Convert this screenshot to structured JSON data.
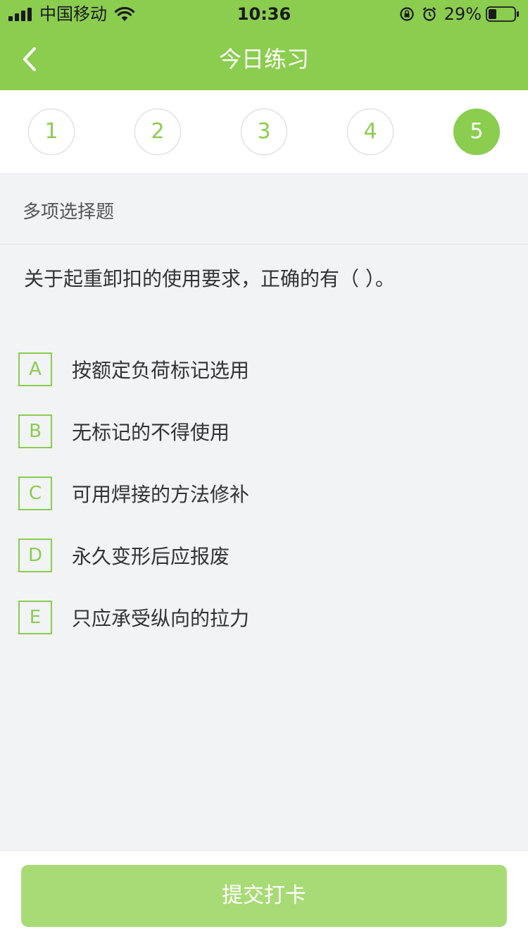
{
  "status_bar": {
    "carrier": "中国移动",
    "time": "10:36",
    "battery": "29%"
  },
  "nav": {
    "title": "今日练习"
  },
  "question_numbers": [
    {
      "label": "1",
      "active": false
    },
    {
      "label": "2",
      "active": false
    },
    {
      "label": "3",
      "active": false
    },
    {
      "label": "4",
      "active": false
    },
    {
      "label": "5",
      "active": true
    }
  ],
  "question": {
    "type": "多项选择题",
    "stem": "关于起重卸扣的使用要求，正确的有（   ）。",
    "options": [
      {
        "letter": "A",
        "text": "按额定负荷标记选用"
      },
      {
        "letter": "B",
        "text": "无标记的不得使用"
      },
      {
        "letter": "C",
        "text": "可用焊接的方法修补"
      },
      {
        "letter": "D",
        "text": "永久变形后应报废"
      },
      {
        "letter": "E",
        "text": "只应承受纵向的拉力"
      }
    ]
  },
  "footer": {
    "submit_label": "提交打卡"
  },
  "colors": {
    "primary": "#8bcd4f",
    "submit": "#a8db76",
    "background": "#f2f3f5"
  }
}
